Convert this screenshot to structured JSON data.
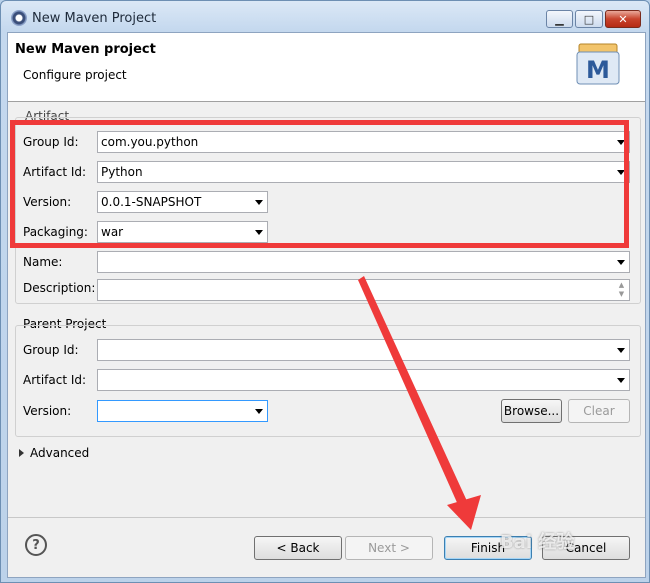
{
  "window": {
    "title": "New Maven Project",
    "buttons": {
      "minimize": "▁",
      "maximize": "□",
      "close": "✕"
    }
  },
  "header": {
    "title": "New Maven project",
    "subtitle": "Configure project",
    "logo_letter": "M"
  },
  "artifact": {
    "section_label": "Artifact",
    "group_id": {
      "label": "Group Id:",
      "value": "com.you.python"
    },
    "artifact_id": {
      "label": "Artifact Id:",
      "value": "Python"
    },
    "version": {
      "label": "Version:",
      "value": "0.0.1-SNAPSHOT"
    },
    "packaging": {
      "label": "Packaging:",
      "value": "war"
    },
    "name": {
      "label": "Name:",
      "value": ""
    },
    "description": {
      "label": "Description:",
      "value": ""
    }
  },
  "parent": {
    "section_label": "Parent Project",
    "group_id": {
      "label": "Group Id:",
      "value": ""
    },
    "artifact_id": {
      "label": "Artifact Id:",
      "value": ""
    },
    "version": {
      "label": "Version:",
      "value": ""
    },
    "browse_label": "Browse...",
    "clear_label": "Clear"
  },
  "advanced": {
    "label": "Advanced"
  },
  "footer": {
    "help_icon": "?",
    "back_label": "< Back",
    "next_label": "Next >",
    "finish_label": "Finish",
    "cancel_label": "Cancel"
  },
  "watermark": "Bai 经验",
  "colors": {
    "highlight": "#ef3a3a",
    "arrow": "#ef3a3a"
  }
}
